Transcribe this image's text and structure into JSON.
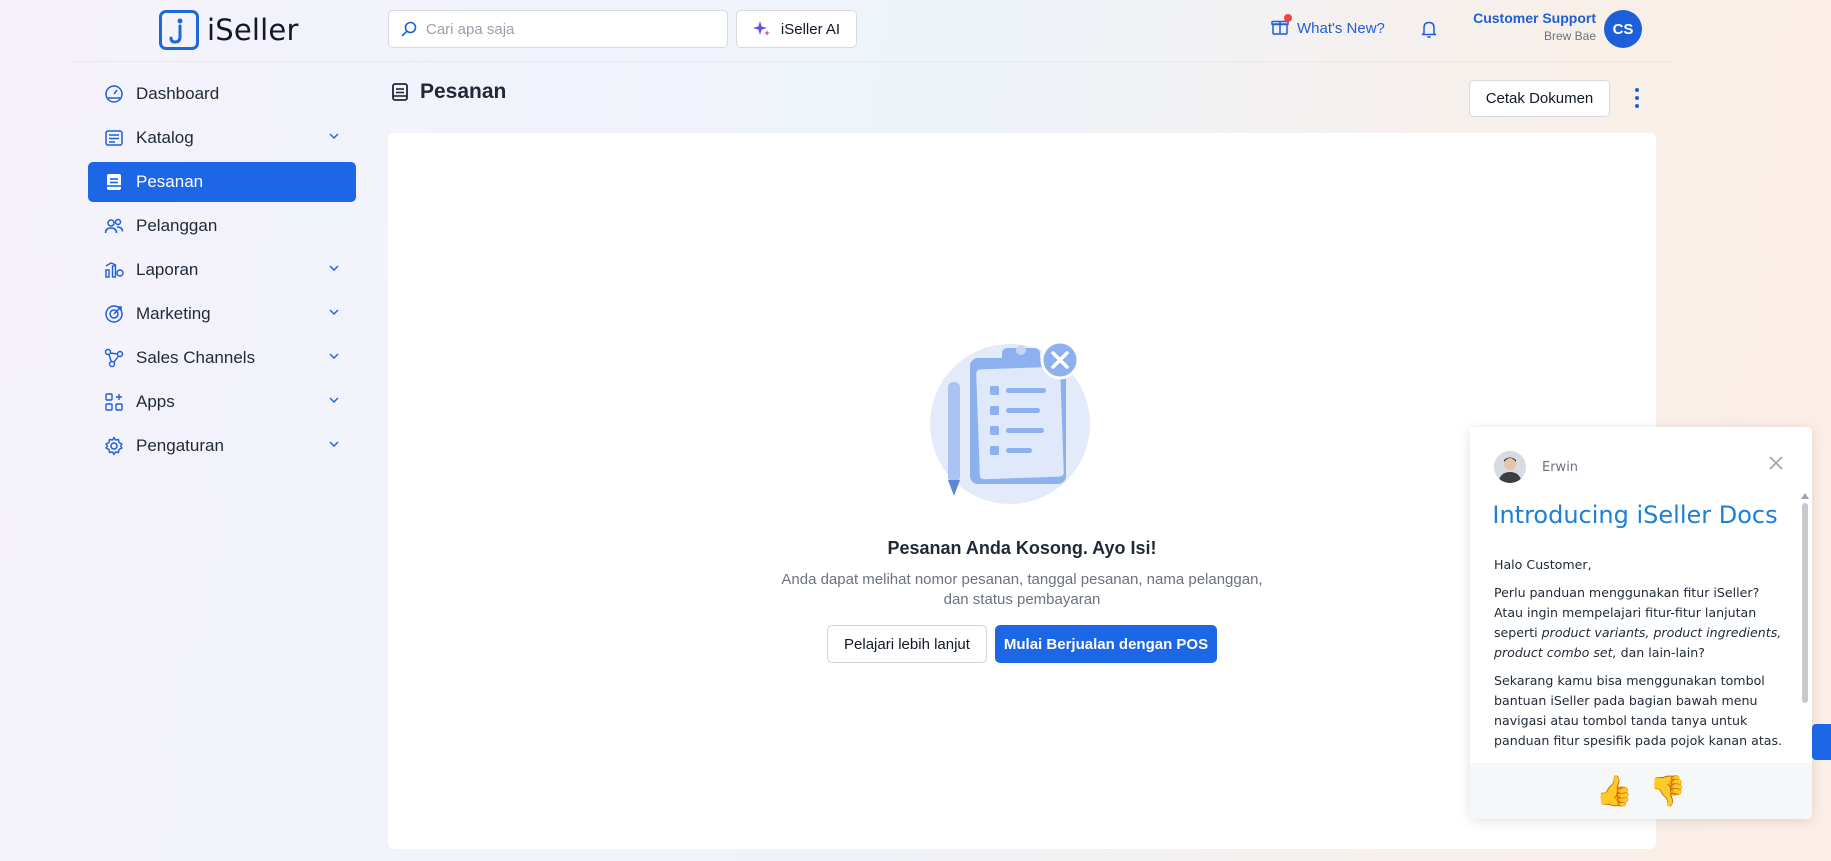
{
  "app": {
    "logo_text": "iSeller"
  },
  "header": {
    "search_placeholder": "Cari apa saja",
    "ai_button_label": "iSeller AI",
    "whats_new_label": "What's New?",
    "account_name": "Customer Support",
    "account_org": "Brew Bae",
    "avatar_initials": "CS"
  },
  "sidebar": {
    "items": [
      {
        "label": "Dashboard",
        "icon": "dashboard-icon",
        "expandable": false,
        "active": false
      },
      {
        "label": "Katalog",
        "icon": "catalog-icon",
        "expandable": true,
        "active": false
      },
      {
        "label": "Pesanan",
        "icon": "orders-icon",
        "expandable": false,
        "active": true
      },
      {
        "label": "Pelanggan",
        "icon": "customers-icon",
        "expandable": false,
        "active": false
      },
      {
        "label": "Laporan",
        "icon": "reports-icon",
        "expandable": true,
        "active": false
      },
      {
        "label": "Marketing",
        "icon": "marketing-icon",
        "expandable": true,
        "active": false
      },
      {
        "label": "Sales Channels",
        "icon": "sales-channels-icon",
        "expandable": true,
        "active": false
      },
      {
        "label": "Apps",
        "icon": "apps-icon",
        "expandable": true,
        "active": false
      },
      {
        "label": "Pengaturan",
        "icon": "settings-icon",
        "expandable": true,
        "active": false
      }
    ]
  },
  "page": {
    "title": "Pesanan",
    "print_button_label": "Cetak Dokumen"
  },
  "empty_state": {
    "title": "Pesanan Anda Kosong. Ayo Isi!",
    "description": "Anda dapat melihat nomor pesanan, tanggal pesanan, nama pelanggan, dan status pembayaran",
    "learn_more_label": "Pelajari lebih lanjut",
    "start_pos_label": "Mulai Berjualan dengan POS"
  },
  "chat_widget": {
    "sender": "Erwin",
    "title": "Introducing iSeller Docs",
    "greeting": "Halo Customer,",
    "para1_a": "Perlu panduan menggunakan fitur iSeller? Atau ingin mempelajari fitur-fitur lanjutan seperti ",
    "para1_em": "product variants, product ingredients, product combo set,",
    "para1_b": " dan lain-lain?",
    "para2": "Sekarang kamu bisa menggunakan tombol bantuan iSeller pada bagian bawah menu navigasi atau tombol tanda tanya untuk panduan fitur spesifik pada pojok kanan atas.",
    "thumbs_up": "👍",
    "thumbs_down": "👎"
  },
  "colors": {
    "accent": "#1d66e6",
    "link": "#1d5fd8",
    "widget_title": "#1d7fd6"
  }
}
